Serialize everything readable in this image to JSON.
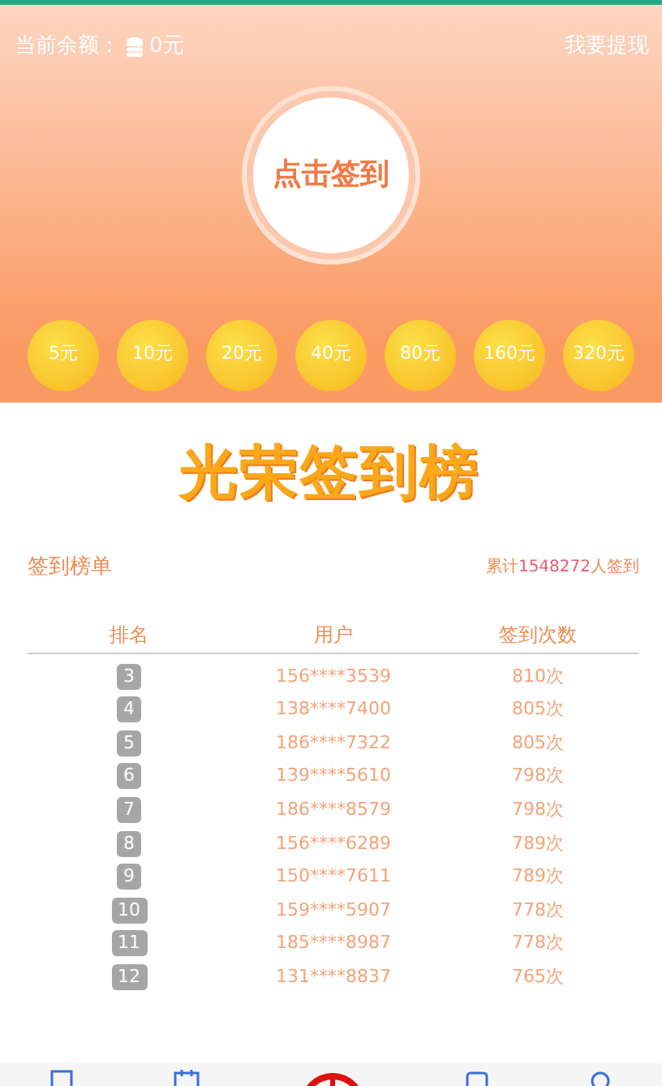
{
  "header": {
    "balance_label": "当前余额：",
    "balance": "0元",
    "withdraw": "我要提现",
    "checkin_button": "点击签到",
    "rewards": [
      {
        "label": "5元"
      },
      {
        "label": "10元"
      },
      {
        "label": "20元"
      },
      {
        "label": "40元"
      },
      {
        "label": "80元"
      },
      {
        "label": "160元"
      },
      {
        "label": "320元"
      }
    ]
  },
  "banner_title": "光荣签到榜",
  "leaderboard": {
    "title": "签到榜单",
    "total_prefix": "累计",
    "total": "1548272",
    "total_suffix": "人签到",
    "columns": [
      "排名",
      "用户",
      "签到次数"
    ],
    "rows": [
      {
        "rank": "3",
        "user": "156****3539",
        "count": "810次"
      },
      {
        "rank": "4",
        "user": "138****7400",
        "count": "805次"
      },
      {
        "rank": "5",
        "user": "186****7322",
        "count": "805次"
      },
      {
        "rank": "6",
        "user": "139****5610",
        "count": "798次"
      },
      {
        "rank": "7",
        "user": "186****8579",
        "count": "798次"
      },
      {
        "rank": "8",
        "user": "156****6289",
        "count": "789次"
      },
      {
        "rank": "9",
        "user": "150****7611",
        "count": "789次"
      },
      {
        "rank": "10",
        "user": "159****5907",
        "count": "778次"
      },
      {
        "rank": "11",
        "user": "185****8987",
        "count": "778次"
      },
      {
        "rank": "12",
        "user": "131****8837",
        "count": "765次"
      }
    ]
  }
}
